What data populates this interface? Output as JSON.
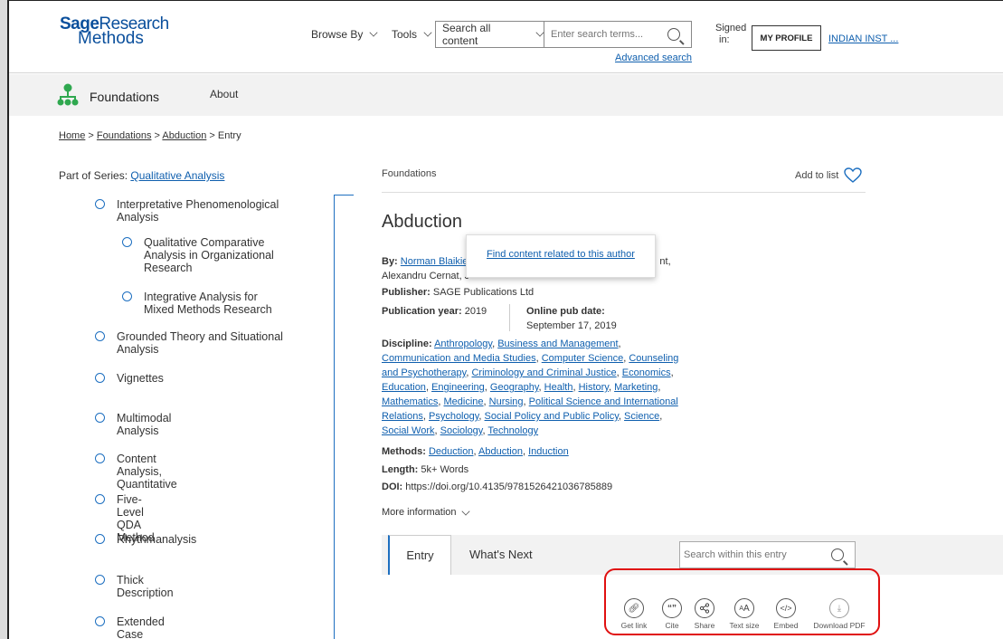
{
  "header": {
    "logo_line1_a": "Sage",
    "logo_line1_b": "Research",
    "logo_line2": "Methods",
    "browse_by": "Browse By",
    "tools": "Tools",
    "search_scope": "Search all content",
    "search_placeholder": "Enter search terms...",
    "advanced_search": "Advanced search",
    "signed_in_1": "Signed",
    "signed_in_2": "in:",
    "my_profile": "MY PROFILE",
    "institution": "INDIAN INST ..."
  },
  "subheader": {
    "title": "Foundations",
    "about": "About"
  },
  "breadcrumb": {
    "home": "Home",
    "foundations": "Foundations",
    "abduction": "Abduction",
    "entry": "Entry",
    "sep": ">"
  },
  "sidebar": {
    "series_label": "Part of Series:",
    "series_name": "Qualitative Analysis",
    "items": [
      {
        "label": "Interpretative Phenomenological Analysis"
      },
      {
        "label": "Qualitative Comparative Analysis in Organizational Research"
      },
      {
        "label": "Integrative Analysis for Mixed Methods Research"
      },
      {
        "label": "Grounded Theory and Situational Analysis"
      },
      {
        "label": "Vignettes"
      },
      {
        "label": "Multimodal Analysis"
      },
      {
        "label": "Content Analysis, Quantitative"
      },
      {
        "label": "Five-Level QDA Method"
      },
      {
        "label": "Rhythmanalysis"
      },
      {
        "label": "Thick Description"
      },
      {
        "label": "Extended Case Method"
      }
    ]
  },
  "main": {
    "series_crumb": "Foundations",
    "add_to_list": "Add to list",
    "title": "Abduction",
    "by_label": "By:",
    "author": "Norman Blaikie",
    "author_rest_1": "nt,",
    "author_rest_2": "Alexandru Cernat, J",
    "popup_text": "Find content related to this author",
    "publisher_label": "Publisher:",
    "publisher": "SAGE Publications Ltd",
    "pub_year_label": "Publication year:",
    "pub_year": "2019",
    "online_pub_label": "Online pub date:",
    "online_pub": "September 17, 2019",
    "discipline_label": "Discipline:",
    "disciplines": [
      "Anthropology",
      "Business and Management",
      "Communication and Media Studies",
      "Computer Science",
      "Counseling and Psychotherapy",
      "Criminology and Criminal Justice",
      "Economics",
      "Education",
      "Engineering",
      "Geography",
      "Health",
      "History",
      "Marketing",
      "Mathematics",
      "Medicine",
      "Nursing",
      "Political Science and International Relations",
      "Psychology",
      "Social Policy and Public Policy",
      "Science",
      "Social Work",
      "Sociology",
      "Technology"
    ],
    "methods_label": "Methods:",
    "methods": [
      "Deduction",
      "Abduction",
      "Induction"
    ],
    "length_label": "Length:",
    "length": "5k+ Words",
    "doi_label": "DOI:",
    "doi": "https://doi.org/10.4135/9781526421036785889",
    "more_info": "More information"
  },
  "tabs": {
    "entry": "Entry",
    "whats_next": "What's Next",
    "search_placeholder": "Search within this entry"
  },
  "tools": {
    "get_link": "Get link",
    "cite": "Cite",
    "share": "Share",
    "text_size": "Text size",
    "embed": "Embed",
    "download_pdf": "Download PDF"
  },
  "colors": {
    "brand": "#0a4f9c",
    "link": "#0f5fae",
    "accent_line": "#1d6fc0",
    "highlight": "#e01010"
  }
}
